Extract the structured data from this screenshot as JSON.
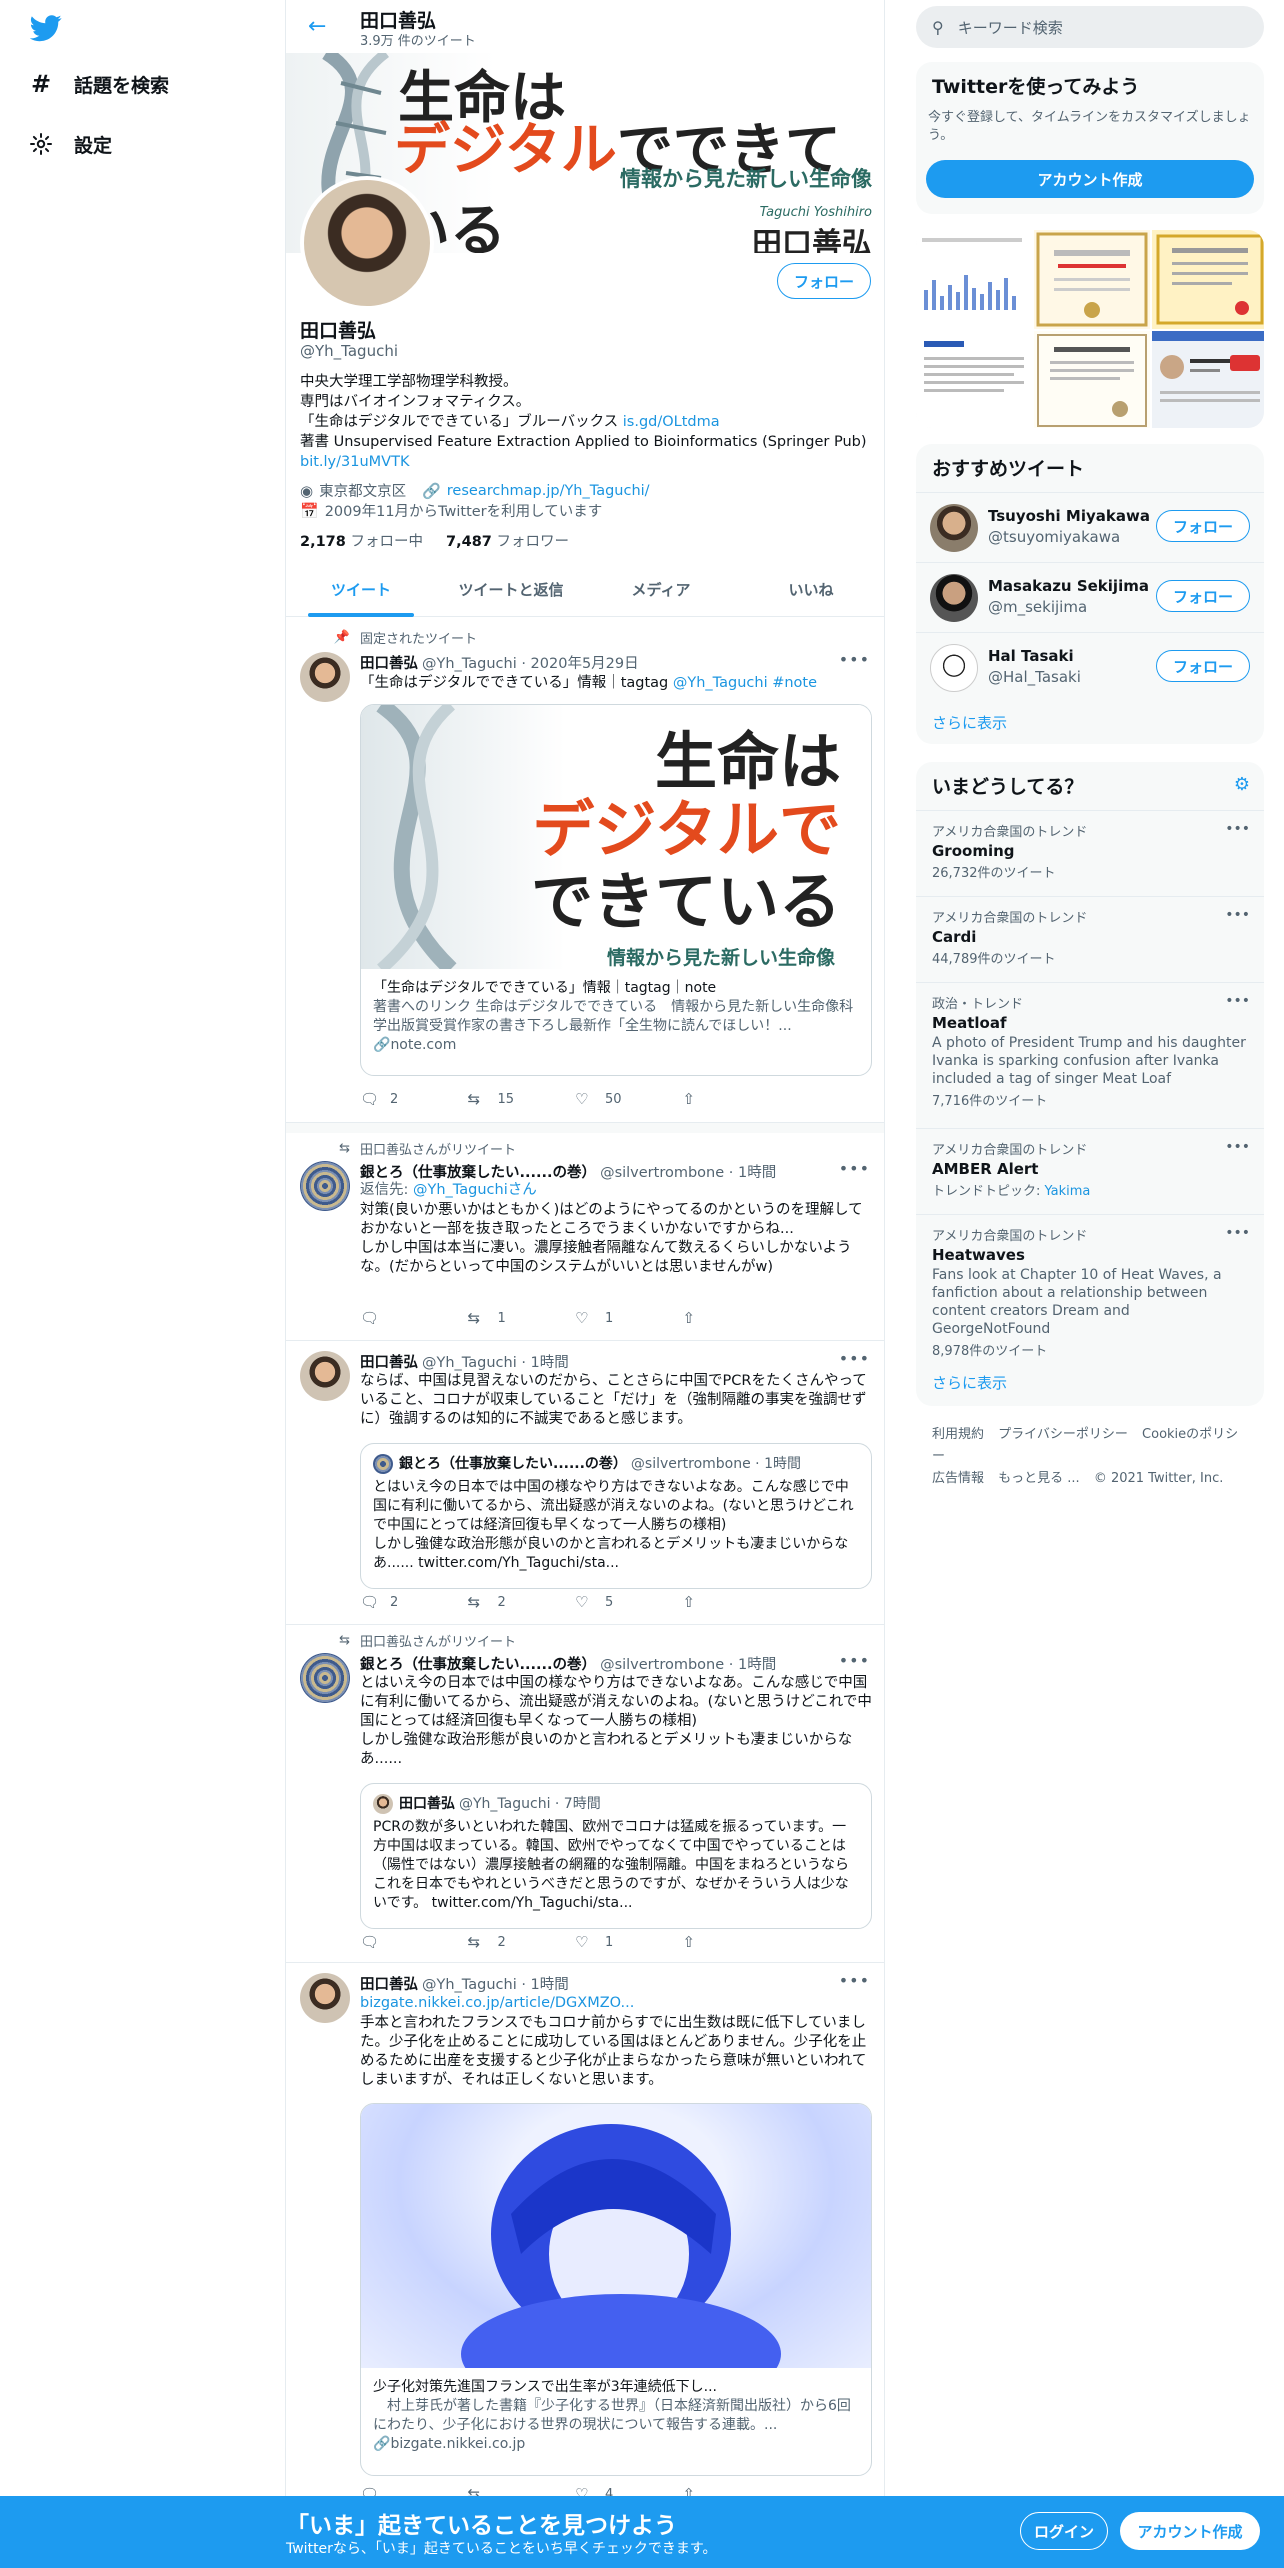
{
  "nav": {
    "explore": "話題を検索",
    "settings": "設定"
  },
  "header": {
    "name": "田口善弘",
    "tweet_count": "3.9万 件のツイート"
  },
  "banner": {
    "line1": "生命は",
    "line2_red": "デジタル",
    "line2_rest": "でできている",
    "subtitle": "情報から見た新しい生命像",
    "author_en": "Taguchi Yoshihiro",
    "author_ja": "田口善弘"
  },
  "profile": {
    "follow": "フォロー",
    "name": "田口善弘",
    "handle": "@Yh_Taguchi",
    "bio_line1": "中央大学理工学部物理学科教授。",
    "bio_line2": "専門はバイオインフォマティクス。",
    "bio_line3_text": "「生命はデジタルでできている」ブルーバックス ",
    "bio_line3_link": "is.gd/OLtdma",
    "bio_line4": "著書 Unsupervised Feature Extraction Applied to Bioinformatics (Springer Pub)",
    "bio_line5_link": "bit.ly/31uMVTK",
    "location": "東京都文京区",
    "website": "researchmap.jp/Yh_Taguchi/",
    "joined": "2009年11月からTwitterを利用しています",
    "following_count": "2,178",
    "following_label": "フォロー中",
    "followers_count": "7,487",
    "followers_label": "フォロワー"
  },
  "tabs": [
    "ツイート",
    "ツイートと返信",
    "メディア",
    "いいね"
  ],
  "tweets": [
    {
      "context": "固定されたツイート",
      "name": "田口善弘",
      "handle": "@Yh_Taguchi · 2020年5月29日",
      "text": "「生命はデジタルでできている」情報｜tagtag ",
      "text_link": "@Yh_Taguchi #note",
      "card_img_line1": "生命は",
      "card_img_line2": "デジタルで",
      "card_img_line3": "できている",
      "card_img_sub": "情報から見た新しい生命像",
      "card_title": "「生命はデジタルでできている」情報｜tagtag｜note",
      "card_desc": "著書へのリンク 生命はデジタルでできている　情報から見た新しい生命像科学出版賞受賞作家の書き下ろし最新作「全生物に読んでほしい！...",
      "card_domain": "note.com",
      "replies": "2",
      "retweets": "15",
      "likes": "50"
    },
    {
      "context": "田口善弘さんがリツイート",
      "name": "銀とろ（仕事放棄したい......の巻）",
      "handle": "@silvertrombone · 1時間",
      "reply_to_label": "返信先: ",
      "reply_to": "@Yh_Taguchiさん",
      "text": "対策(良いか悪いかはともかく)はどのようにやってるのかというのを理解しておかないと一部を抜き取ったところでうまくいかないですからね...\nしかし中国は本当に凄い。濃厚接触者隔離なんて数えるくらいしかないような。(だからといって中国のシステムがいいとは思いませんがw)",
      "replies": "",
      "retweets": "1",
      "likes": "1"
    },
    {
      "name": "田口善弘",
      "handle": "@Yh_Taguchi · 1時間",
      "text": "ならば、中国は見習えないのだから、ことさらに中国でPCRをたくさんやっていること、コロナが収束していること「だけ」を（強制隔離の事実を強調せずに）強調するのは知的に不誠実であると感じます。",
      "quote_name": "銀とろ（仕事放棄したい......の巻）",
      "quote_handle": "@silvertrombone · 1時間",
      "quote_text": "とはいえ今の日本では中国の様なやり方はできないよなあ。こんな感じで中国に有利に働いてるから、流出疑惑が消えないのよね。(ないと思うけどこれで中国にとっては経済回復も早くなって一人勝ちの様相)\nしかし強健な政治形態が良いのかと言われるとデメリットも凄まじいからなあ...... twitter.com/Yh_Taguchi/sta...",
      "replies": "2",
      "retweets": "2",
      "likes": "5"
    },
    {
      "context": "田口善弘さんがリツイート",
      "name": "銀とろ（仕事放棄したい......の巻）",
      "handle": "@silvertrombone · 1時間",
      "text": "とはいえ今の日本では中国の様なやり方はできないよなあ。こんな感じで中国に有利に働いてるから、流出疑惑が消えないのよね。(ないと思うけどこれで中国にとっては経済回復も早くなって一人勝ちの様相)\nしかし強健な政治形態が良いのかと言われるとデメリットも凄まじいからなあ......",
      "quote_name": "田口善弘",
      "quote_handle": "@Yh_Taguchi · 7時間",
      "quote_text": "PCRの数が多いといわれた韓国、欧州でコロナは猛威を振るっています。一方中国は収まっている。韓国、欧州でやってなくて中国でやっていることは（陽性ではない）濃厚接触者の網羅的な強制隔離。中国をまねろというならこれを日本でもやれというべきだと思うのですが、なぜかそういう人は少ないです。 twitter.com/Yh_Taguchi/sta...",
      "replies": "",
      "retweets": "2",
      "likes": "1"
    },
    {
      "name": "田口善弘",
      "handle": "@Yh_Taguchi · 1時間",
      "text_link": "bizgate.nikkei.co.jp/article/DGXMZO...",
      "text": "手本と言われたフランスでもコロナ前からすでに出生数は既に低下していました。少子化を止めることに成功している国はほとんどありません。少子化を止めるために出産を支援すると少子化が止まらなかったら意味が無いといわれてしまいますが、それは正しくないと思います。",
      "card_title": "少子化対策先進国フランスで出生率が3年連続低下し...",
      "card_desc": "　村上芽氏が著した書籍『少子化する世界』（日本経済新聞出版社）から6回にわたり、少子化における世界の現状について報告する連載。...",
      "card_domain": "bizgate.nikkei.co.jp",
      "retweets": "",
      "likes": "4"
    }
  ],
  "right": {
    "search_placeholder": "キーワード検索",
    "signup_box": {
      "title": "Twitterを使ってみよう",
      "desc": "今すぐ登録して、タイムラインをカスタマイズしましょう。",
      "button": "アカウント作成"
    },
    "who_to_follow": {
      "title": "おすすめツイート",
      "users": [
        {
          "name": "Tsuyoshi Miyakawa",
          "handle": "@tsuyomiyakawa",
          "button": "フォロー"
        },
        {
          "name": "Masakazu Sekijima",
          "handle": "@m_sekijima",
          "button": "フォロー"
        },
        {
          "name": "Hal Tasaki",
          "handle": "@Hal_Tasaki",
          "button": "フォロー"
        }
      ],
      "show_more": "さらに表示"
    },
    "trends": {
      "title": "いまどうしてる？",
      "items": [
        {
          "context": "アメリカ合衆国のトレンド",
          "name": "Grooming",
          "count": "26,732件のツイート"
        },
        {
          "context": "アメリカ合衆国のトレンド",
          "name": "Cardi",
          "count": "44,789件のツイート"
        },
        {
          "context": "政治・トレンド",
          "name": "Meatloaf",
          "desc": "A photo of President Trump and his daughter Ivanka is sparking confusion after Ivanka included a tag of singer Meat Loaf",
          "count": "7,716件のツイート"
        },
        {
          "context": "アメリカ合衆国のトレンド",
          "name": "AMBER Alert",
          "topic_label": "トレンドトピック: ",
          "topic": "Yakima"
        },
        {
          "context": "アメリカ合衆国のトレンド",
          "name": "Heatwaves",
          "desc": "Fans look at Chapter 10 of Heat Waves, a fanfiction about a relationship between content creators Dream and GeorgeNotFound",
          "count": "8,978件のツイート"
        }
      ],
      "show_more": "さらに表示"
    },
    "footer": {
      "terms": "利用規約",
      "privacy": "プライバシーポリシー",
      "cookies": "Cookieのポリシー",
      "ads": "広告情報",
      "more": "もっと見る ...",
      "copyright": "© 2021 Twitter, Inc."
    }
  },
  "bottombar": {
    "title": "「いま」起きていることを見つけよう",
    "subtitle": "Twitterなら、「いま」起きていることをいち早くチェックできます。",
    "login": "ログイン",
    "signup": "アカウント作成"
  },
  "colors": {
    "accent": "#1d9bf0",
    "bottom_bar": "#1d9bf0",
    "banner_red": "#e34a1d",
    "banner_green": "#2b6b63"
  }
}
